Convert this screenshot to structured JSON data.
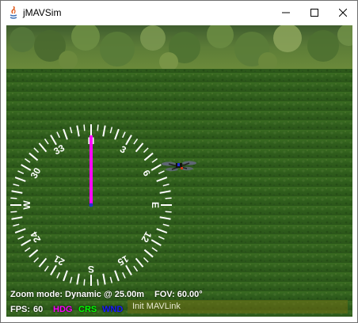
{
  "window": {
    "title": "jMAVSim",
    "minimize_icon": "minimize-icon",
    "maximize_icon": "maximize-icon",
    "close_icon": "close-icon"
  },
  "compass": {
    "north_label": "N",
    "east_label": "E",
    "south_label": "S",
    "west_label": "W",
    "ring_labels": [
      "3",
      "6",
      "12",
      "15",
      "21",
      "24",
      "30",
      "33"
    ],
    "heading_color": "#ff00ff"
  },
  "hud": {
    "zoom_mode": "Zoom mode: Dynamic @ 25.00m",
    "fov": "FOV: 60.00°",
    "fps_label": "FPS:",
    "fps_value": "60",
    "hdg_label": "HDG",
    "crs_label": "CRS",
    "wnd_label": "WND",
    "hdg_color": "#ff00ff",
    "crs_color": "#00ff00",
    "wnd_color": "#0000ff"
  },
  "status": {
    "message": "Init MAVLink"
  }
}
